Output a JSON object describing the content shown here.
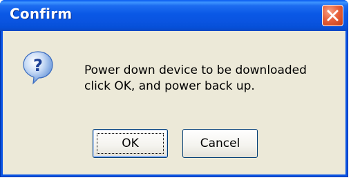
{
  "dialog": {
    "title": "Confirm",
    "icon": "question-icon",
    "message_lines": [
      "Power down device to be downloaded",
      "click OK, and power back up."
    ],
    "buttons": {
      "ok_label": "OK",
      "cancel_label": "Cancel"
    },
    "colors": {
      "titlebar": "#0a54e4",
      "close_button": "#e8623c",
      "client_background": "#ece9d8"
    }
  }
}
